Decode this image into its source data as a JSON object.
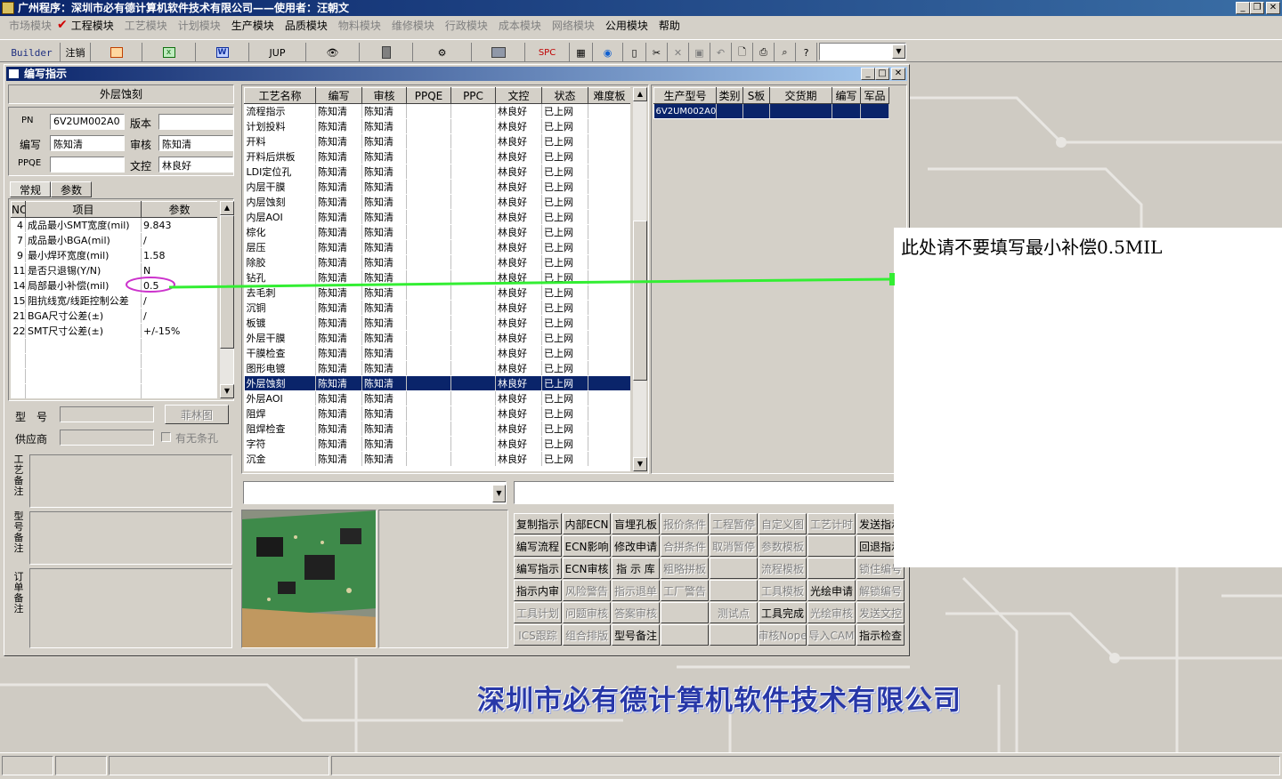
{
  "app_title": "广州程序：深圳市必有德计算机软件技术有限公司——使用者：汪朝文",
  "menu": [
    "市场模块",
    "工程模块",
    "工艺模块",
    "计划模块",
    "生产模块",
    "品质模块",
    "物料模块",
    "维修模块",
    "行政模块",
    "成本模块",
    "网络模块",
    "公用模块",
    "帮助"
  ],
  "menu_active": [
    false,
    true,
    false,
    false,
    true,
    true,
    false,
    false,
    false,
    false,
    false,
    true,
    true
  ],
  "toolbar": {
    "builder": "Builder",
    "logout": "注销",
    "jup": "JUP",
    "spc": "SPC"
  },
  "window_title": "编写指示",
  "process_name": "外层蚀刻",
  "form": {
    "pn_label": "PN",
    "pn": "6V2UM002A0",
    "version_label": "版本",
    "version": "",
    "author_label": "编写",
    "author": "陈知清",
    "review_label": "审核",
    "review": "陈知清",
    "ppqe_label": "PPQE",
    "ppqe": "",
    "doc_label": "文控",
    "doc": "林良好"
  },
  "tabs": [
    "常规",
    "参数"
  ],
  "param_table": {
    "headers": [
      "NO",
      "项目",
      "参数"
    ],
    "rows": [
      [
        "4",
        "成品最小SMT宽度(mil)",
        "9.843"
      ],
      [
        "7",
        "成品最小BGA(mil)",
        "/"
      ],
      [
        "9",
        "最小焊环宽度(mil)",
        "1.58"
      ],
      [
        "11",
        "是否只退锡(Y/N)",
        "N"
      ],
      [
        "14",
        "局部最小补偿(mil)",
        "0.5"
      ],
      [
        "15",
        "阻抗线宽/线距控制公差",
        "/"
      ],
      [
        "21",
        "BGA尺寸公差(±)",
        "/"
      ],
      [
        "22",
        "SMT尺寸公差(±)",
        "+/-15%"
      ]
    ]
  },
  "model_label": "型　号",
  "fly_button": "菲林图",
  "supplier_label": "供应商",
  "no_slot_label": "有无条孔",
  "remarks": {
    "process": "工艺备注",
    "model": "型号备注",
    "order": "订单备注"
  },
  "steps_table": {
    "headers": [
      "工艺名称",
      "编写",
      "审核",
      "PPQE",
      "PPC",
      "文控",
      "状态",
      "难度板"
    ],
    "rows": [
      [
        "流程指示",
        "陈知清",
        "陈知清",
        "",
        "",
        "林良好",
        "已上网",
        ""
      ],
      [
        "计划投料",
        "陈知清",
        "陈知清",
        "",
        "",
        "林良好",
        "已上网",
        ""
      ],
      [
        "开料",
        "陈知清",
        "陈知清",
        "",
        "",
        "林良好",
        "已上网",
        ""
      ],
      [
        "开料后烘板",
        "陈知清",
        "陈知清",
        "",
        "",
        "林良好",
        "已上网",
        ""
      ],
      [
        "LDI定位孔",
        "陈知清",
        "陈知清",
        "",
        "",
        "林良好",
        "已上网",
        ""
      ],
      [
        "内层干膜",
        "陈知清",
        "陈知清",
        "",
        "",
        "林良好",
        "已上网",
        ""
      ],
      [
        "内层蚀刻",
        "陈知清",
        "陈知清",
        "",
        "",
        "林良好",
        "已上网",
        ""
      ],
      [
        "内层AOI",
        "陈知清",
        "陈知清",
        "",
        "",
        "林良好",
        "已上网",
        ""
      ],
      [
        "棕化",
        "陈知清",
        "陈知清",
        "",
        "",
        "林良好",
        "已上网",
        ""
      ],
      [
        "层压",
        "陈知清",
        "陈知清",
        "",
        "",
        "林良好",
        "已上网",
        ""
      ],
      [
        "除胶",
        "陈知清",
        "陈知清",
        "",
        "",
        "林良好",
        "已上网",
        ""
      ],
      [
        "钻孔",
        "陈知清",
        "陈知清",
        "",
        "",
        "林良好",
        "已上网",
        ""
      ],
      [
        "去毛刺",
        "陈知清",
        "陈知清",
        "",
        "",
        "林良好",
        "已上网",
        ""
      ],
      [
        "沉铜",
        "陈知清",
        "陈知清",
        "",
        "",
        "林良好",
        "已上网",
        ""
      ],
      [
        "板镀",
        "陈知清",
        "陈知清",
        "",
        "",
        "林良好",
        "已上网",
        ""
      ],
      [
        "外层干膜",
        "陈知清",
        "陈知清",
        "",
        "",
        "林良好",
        "已上网",
        ""
      ],
      [
        "干膜检查",
        "陈知清",
        "陈知清",
        "",
        "",
        "林良好",
        "已上网",
        ""
      ],
      [
        "图形电镀",
        "陈知清",
        "陈知清",
        "",
        "",
        "林良好",
        "已上网",
        ""
      ],
      [
        "外层蚀刻",
        "陈知清",
        "陈知清",
        "",
        "",
        "林良好",
        "已上网",
        ""
      ],
      [
        "外层AOI",
        "陈知清",
        "陈知清",
        "",
        "",
        "林良好",
        "已上网",
        ""
      ],
      [
        "阻焊",
        "陈知清",
        "陈知清",
        "",
        "",
        "林良好",
        "已上网",
        ""
      ],
      [
        "阻焊检查",
        "陈知清",
        "陈知清",
        "",
        "",
        "林良好",
        "已上网",
        ""
      ],
      [
        "字符",
        "陈知清",
        "陈知清",
        "",
        "",
        "林良好",
        "已上网",
        ""
      ],
      [
        "沉金",
        "陈知清",
        "陈知清",
        "",
        "",
        "林良好",
        "已上网",
        ""
      ]
    ],
    "selected_index": 18
  },
  "orders_table": {
    "headers": [
      "生产型号",
      "类别",
      "S板",
      "交货期",
      "编写",
      "军品"
    ],
    "rows": [
      [
        "6V2UM002A0",
        "",
        "",
        "",
        "",
        ""
      ]
    ]
  },
  "buttons": [
    [
      "复制指示",
      "内部ECN",
      "盲埋孔板",
      "报价条件",
      "工程暂停",
      "自定义图",
      "工艺计时",
      "发送指示"
    ],
    [
      "编写流程",
      "ECN影响",
      "修改申请",
      "合拼条件",
      "取消暂停",
      "参数模板",
      "",
      "回退指示"
    ],
    [
      "编写指示",
      "ECN审核",
      "指 示 库",
      "粗略拼板",
      "",
      "流程模板",
      "",
      "锁住编号"
    ],
    [
      "指示内审",
      "风险警告",
      "指示退单",
      "工厂警告",
      "",
      "工具模板",
      "光绘申请",
      "解锁编号"
    ],
    [
      "工具计划",
      "问题审核",
      "答案审核",
      "",
      "测试点",
      "工具完成",
      "光绘审核",
      "发送文控"
    ],
    [
      "ICS跟踪",
      "组合排版",
      "型号备注",
      "",
      "",
      "审核Nope",
      "导入CAM",
      "指示检查"
    ]
  ],
  "buttons_enabled": [
    [
      true,
      true,
      true,
      false,
      false,
      false,
      false,
      true
    ],
    [
      true,
      true,
      true,
      false,
      false,
      false,
      false,
      true
    ],
    [
      true,
      true,
      true,
      false,
      false,
      false,
      false,
      false
    ],
    [
      true,
      false,
      false,
      false,
      false,
      false,
      true,
      false
    ],
    [
      false,
      false,
      false,
      false,
      false,
      true,
      false,
      false
    ],
    [
      false,
      false,
      true,
      false,
      false,
      false,
      false,
      true
    ]
  ],
  "annotation_text": "此处请不要填写最小补偿0.5MIL",
  "company_banner": "深圳市必有德计算机软件技术有限公司",
  "colors": {
    "selection": "#0a246a",
    "annotation_line": "#33ee33",
    "highlight_circle": "#cc33cc",
    "banner": "#2838a8"
  }
}
